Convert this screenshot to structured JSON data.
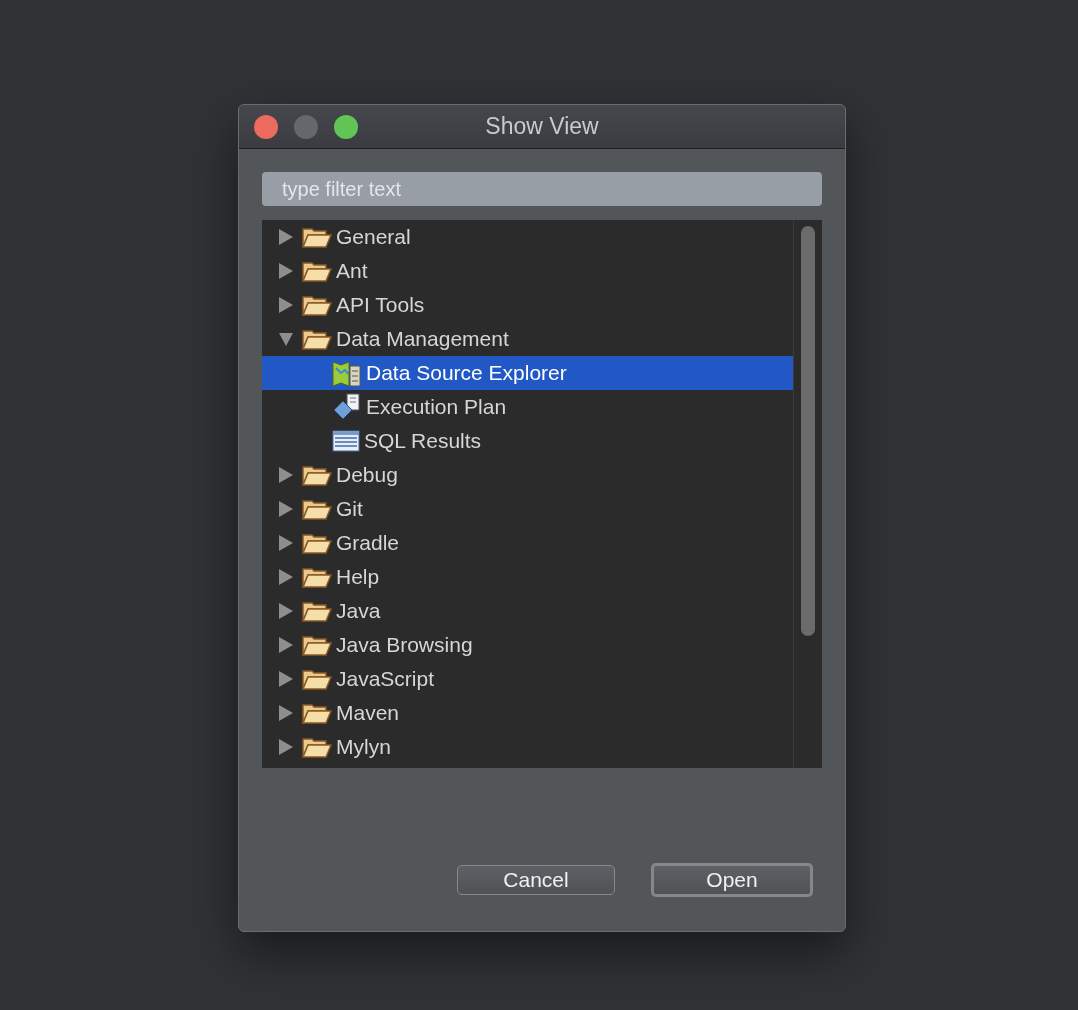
{
  "window": {
    "title": "Show View"
  },
  "filter": {
    "placeholder": "type filter text"
  },
  "tree": [
    {
      "label": "General",
      "expanded": false
    },
    {
      "label": "Ant",
      "expanded": false
    },
    {
      "label": "API Tools",
      "expanded": false
    },
    {
      "label": "Data Management",
      "expanded": true,
      "children": [
        {
          "label": "Data Source Explorer",
          "kind": "explorer",
          "selected": true
        },
        {
          "label": "Execution Plan",
          "kind": "plan",
          "selected": false
        },
        {
          "label": "SQL Results",
          "kind": "table",
          "selected": false
        }
      ]
    },
    {
      "label": "Debug",
      "expanded": false
    },
    {
      "label": "Git",
      "expanded": false
    },
    {
      "label": "Gradle",
      "expanded": false
    },
    {
      "label": "Help",
      "expanded": false
    },
    {
      "label": "Java",
      "expanded": false
    },
    {
      "label": "Java Browsing",
      "expanded": false
    },
    {
      "label": "JavaScript",
      "expanded": false
    },
    {
      "label": "Maven",
      "expanded": false
    },
    {
      "label": "Mylyn",
      "expanded": false
    }
  ],
  "buttons": [
    {
      "label": "Cancel",
      "kind": "normal"
    },
    {
      "label": "Open",
      "kind": "default"
    }
  ]
}
